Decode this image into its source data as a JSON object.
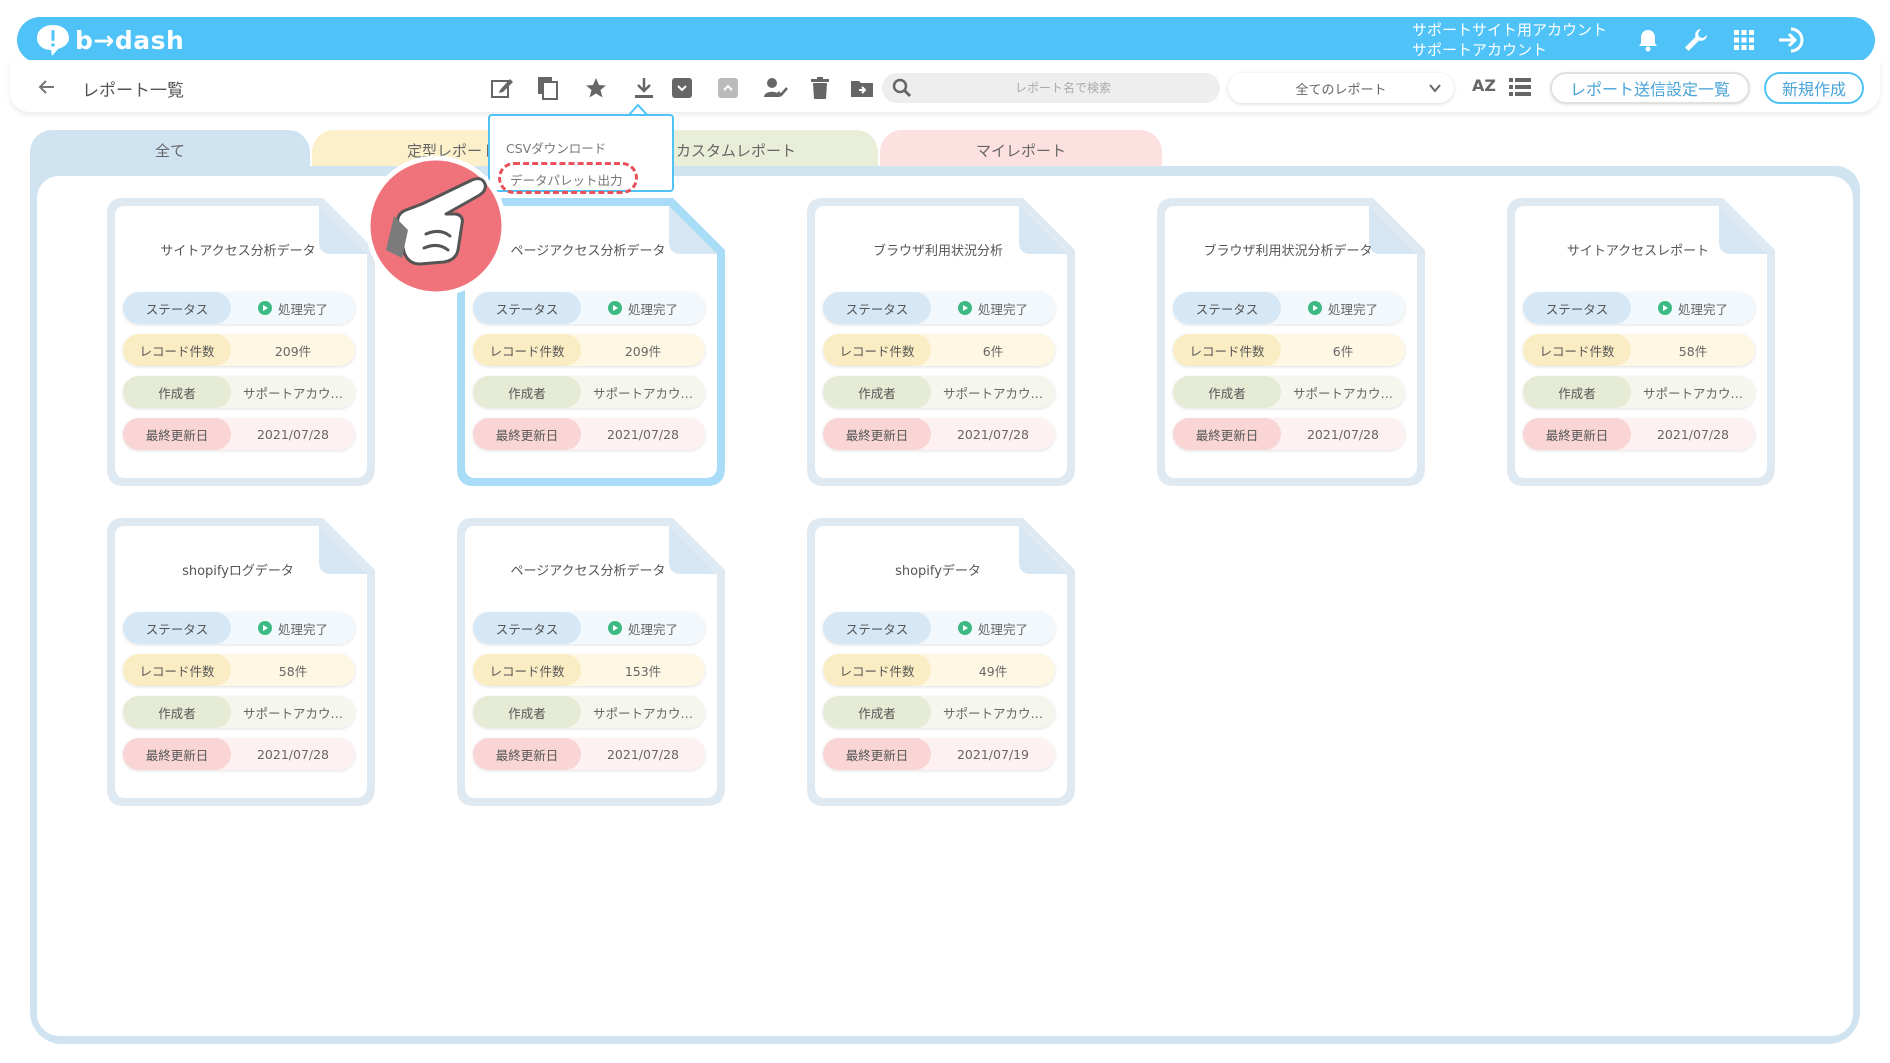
{
  "header": {
    "logo_text": "b→dash",
    "account_line1": "サポートサイト用アカウント",
    "account_line2": "サポートアカウント"
  },
  "toolbar": {
    "page_title": "レポート一覧",
    "search_placeholder": "レポート名で検索",
    "filter_value": "全てのレポート",
    "sort_label": "AZ",
    "send_settings_label": "レポート送信設定一覧",
    "new_label": "新規作成"
  },
  "tabs": {
    "all": "全て",
    "fixed": "定型レポート",
    "custom": "カスタムレポート",
    "my": "マイレポート"
  },
  "dropdown": {
    "csv": "CSVダウンロード",
    "palette": "データパレット出力"
  },
  "labels": {
    "status": "ステータス",
    "records": "レコード件数",
    "author": "作成者",
    "updated": "最終更新日"
  },
  "cards": [
    {
      "title": "サイトアクセス分析データ",
      "status": "処理完了",
      "records": "209件",
      "author": "サポートアカウ…",
      "updated": "2021/07/28",
      "selected": false
    },
    {
      "title": "ページアクセス分析データ",
      "status": "処理完了",
      "records": "209件",
      "author": "サポートアカウ…",
      "updated": "2021/07/28",
      "selected": true
    },
    {
      "title": "ブラウザ利用状況分析",
      "status": "処理完了",
      "records": "6件",
      "author": "サポートアカウ…",
      "updated": "2021/07/28",
      "selected": false
    },
    {
      "title": "ブラウザ利用状況分析データ",
      "status": "処理完了",
      "records": "6件",
      "author": "サポートアカウ…",
      "updated": "2021/07/28",
      "selected": false
    },
    {
      "title": "サイトアクセスレポート",
      "status": "処理完了",
      "records": "58件",
      "author": "サポートアカウ…",
      "updated": "2021/07/28",
      "selected": false
    },
    {
      "title": "shopifyログデータ",
      "status": "処理完了",
      "records": "58件",
      "author": "サポートアカウ…",
      "updated": "2021/07/28",
      "selected": false
    },
    {
      "title": "ページアクセス分析データ",
      "status": "処理完了",
      "records": "153件",
      "author": "サポートアカウ…",
      "updated": "2021/07/28",
      "selected": false
    },
    {
      "title": "shopifyデータ",
      "status": "処理完了",
      "records": "49件",
      "author": "サポートアカウ…",
      "updated": "2021/07/19",
      "selected": false
    }
  ],
  "colors": {
    "brand": "#4fc3f7",
    "status_ok": "#3dba84",
    "highlight": "#e8505b"
  }
}
